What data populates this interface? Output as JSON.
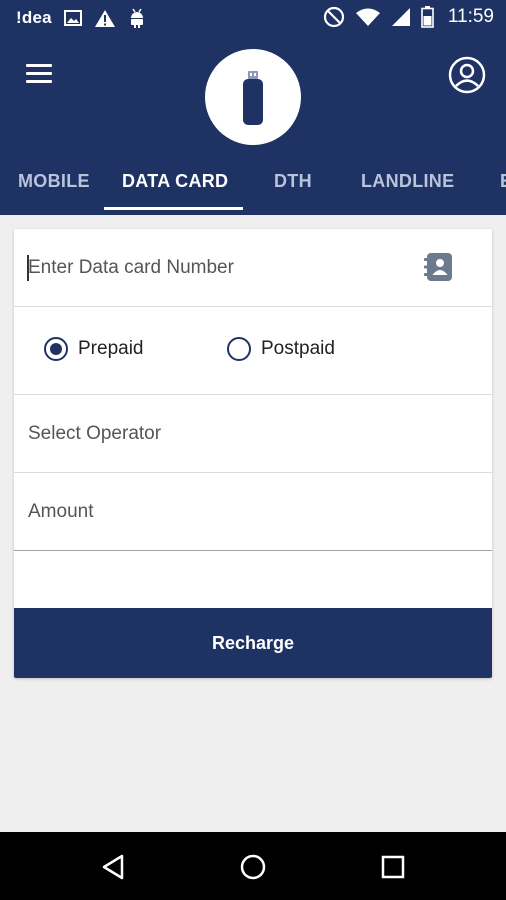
{
  "status_bar": {
    "carrier": "!dea",
    "time": "11:59",
    "icons": [
      "image-icon",
      "warning-icon",
      "android-icon",
      "do-not-disturb-icon",
      "wifi-icon",
      "signal-icon",
      "battery-icon"
    ]
  },
  "header": {
    "menu_icon": "hamburger-menu-icon",
    "logo_icon": "usb-data-card-icon",
    "profile_icon": "account-circle-icon"
  },
  "tabs": {
    "items": [
      {
        "label": "MOBILE"
      },
      {
        "label": "DATA CARD"
      },
      {
        "label": "DTH"
      },
      {
        "label": "LANDLINE"
      },
      {
        "label": "E"
      }
    ],
    "active_index": 1
  },
  "form": {
    "number_placeholder": "Enter Data card Number",
    "contact_icon": "contacts-book-icon",
    "radio_options": [
      {
        "label": "Prepaid",
        "selected": true
      },
      {
        "label": "Postpaid",
        "selected": false
      }
    ],
    "operator_placeholder": "Select Operator",
    "amount_placeholder": "Amount",
    "submit_label": "Recharge"
  },
  "nav": {
    "icons": [
      "back-icon",
      "home-icon",
      "recents-icon"
    ]
  },
  "colors": {
    "primary": "#1e3264",
    "background": "#efefef",
    "tab_inactive": "#b9c3da"
  }
}
